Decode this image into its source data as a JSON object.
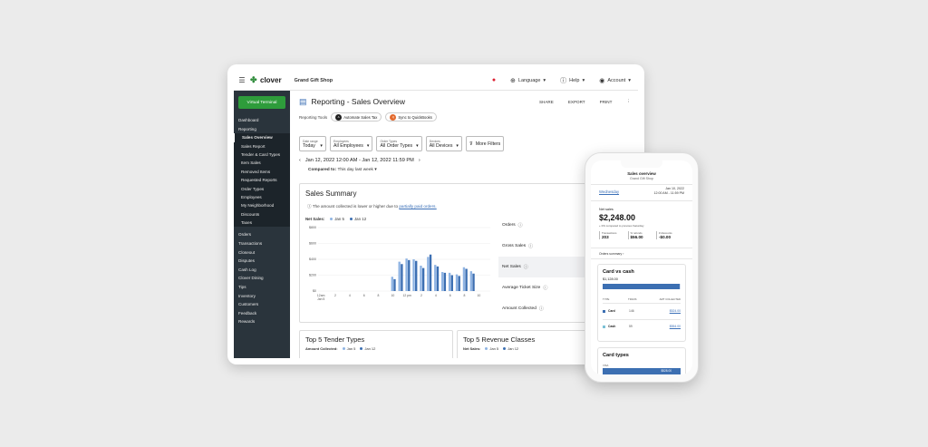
{
  "laptop": {
    "topbar": {
      "brand": "clover",
      "merchant": "Grand Gift Shop",
      "language": "Language",
      "help": "Help",
      "account": "Account"
    },
    "sidebar": {
      "virtual_terminal": "Virtual Terminal",
      "items": [
        {
          "label": "Dashboard",
          "type": "item"
        },
        {
          "label": "Reporting",
          "type": "item"
        },
        {
          "label": "Sales Overview",
          "type": "sub",
          "active": true
        },
        {
          "label": "Sales Report",
          "type": "sub"
        },
        {
          "label": "Tender & Card Types",
          "type": "sub"
        },
        {
          "label": "Item Sales",
          "type": "sub"
        },
        {
          "label": "Removed Items",
          "type": "sub"
        },
        {
          "label": "Requested Reports",
          "type": "sub"
        },
        {
          "label": "Order Types",
          "type": "sub"
        },
        {
          "label": "Employees",
          "type": "sub"
        },
        {
          "label": "My Neighborhood",
          "type": "sub"
        },
        {
          "label": "Discounts",
          "type": "sub"
        },
        {
          "label": "Taxes",
          "type": "sub"
        },
        {
          "label": "Orders",
          "type": "item"
        },
        {
          "label": "Transactions",
          "type": "item"
        },
        {
          "label": "Closeout",
          "type": "item"
        },
        {
          "label": "Disputes",
          "type": "item"
        },
        {
          "label": "Cash Log",
          "type": "item"
        },
        {
          "label": "Clover Dining",
          "type": "item"
        },
        {
          "label": "Tips",
          "type": "item"
        },
        {
          "label": "Inventory",
          "type": "item"
        },
        {
          "label": "Customers",
          "type": "item"
        },
        {
          "label": "Feedback",
          "type": "item"
        },
        {
          "label": "Rewards",
          "type": "item"
        }
      ]
    },
    "page": {
      "title": "Reporting - Sales Overview",
      "actions": [
        "SHARE",
        "EXPORT",
        "PRINT"
      ],
      "tools_label": "Reporting Tools",
      "tool_chips": [
        "Automate Sales Tax",
        "Sync to QuickBooks"
      ],
      "filters": [
        {
          "label": "Date range",
          "value": "Today"
        },
        {
          "label": "Employees",
          "value": "All Employees"
        },
        {
          "label": "Order Types",
          "value": "All Order Types"
        },
        {
          "label": "Devices",
          "value": "All Devices"
        }
      ],
      "more_filters": "More Filters",
      "date_range": "Jan 12, 2022 12:00 AM - Jan 12, 2022 11:59 PM",
      "compared_label": "Compared to:",
      "compared_value": "This day last week",
      "trends_button": "TRENDS"
    },
    "summary": {
      "title": "Sales Summary",
      "note_prefix": "The amount collected is lower or higher due to",
      "note_link": "partially paid orders.",
      "metrics": [
        "Orders",
        "Gross Sales",
        "Net Sales",
        "Average Ticket Size",
        "Amount Collected"
      ],
      "active_metric": 2
    },
    "top5": {
      "tender_title": "Top 5 Tender Types",
      "tender_series_label": "Amount Collected:",
      "revenue_title": "Top 5 Revenue Classes",
      "revenue_series_label": "Net Sales:",
      "legend": [
        "Jan 5",
        "Jan 12"
      ]
    }
  },
  "chart_data": {
    "type": "bar",
    "title": "",
    "series_label": "Net Sales:",
    "categories": [
      "12am\nJan 5",
      "2",
      "4",
      "6",
      "8",
      "10",
      "12 pm",
      "2",
      "4",
      "6",
      "8",
      "10"
    ],
    "ytick_labels": [
      "$0",
      "$200",
      "$400",
      "$600",
      "$800"
    ],
    "ylim": [
      0,
      800
    ],
    "bin_count": 24,
    "series": [
      {
        "name": "Jan 5",
        "color": "#8fb4e3",
        "values": [
          0,
          0,
          0,
          0,
          0,
          0,
          0,
          0,
          0,
          0,
          180,
          370,
          410,
          400,
          320,
          430,
          330,
          240,
          230,
          210,
          300,
          250,
          0,
          0
        ]
      },
      {
        "name": "Jan 12",
        "color": "#3c6fb2",
        "values": [
          0,
          0,
          0,
          0,
          0,
          0,
          0,
          0,
          0,
          0,
          150,
          340,
          390,
          380,
          290,
          460,
          310,
          230,
          200,
          190,
          280,
          220,
          0,
          0
        ]
      }
    ],
    "legend_position": "top-left"
  },
  "phone": {
    "title": "Sales overview",
    "merchant": "Grand Gift Shop",
    "day": "Wednesday",
    "date_line1": "Jan 10, 2022",
    "date_line2": "12:00 AM - 11:59 PM",
    "net_sales_label": "Net sales",
    "net_sales_value": "$2,248.00",
    "compare_text": "+ 0% compared to previous Saturday",
    "stats": [
      {
        "label": "Transactions",
        "value": "203"
      },
      {
        "label": "% refunds",
        "value": "$56.00"
      },
      {
        "label": "# discounts",
        "value": "-$0.00"
      }
    ],
    "orders_summary": "Orders summary",
    "card_vs_cash": {
      "title": "Card vs cash",
      "amount": "$1,128.00",
      "card_share": 0.99,
      "headers": [
        "TYPE",
        "TRANS",
        "AMT COLLECTED"
      ],
      "rows": [
        {
          "type": "Card",
          "trans": "146",
          "amount": "$524.00",
          "color": "#3c6fb2"
        },
        {
          "type": "Cash",
          "trans": "59",
          "amount": "$554.00",
          "color": "#7bc0d6"
        }
      ]
    },
    "card_types": {
      "title": "Card types",
      "label": "VISA",
      "amount": "$528.00"
    }
  }
}
